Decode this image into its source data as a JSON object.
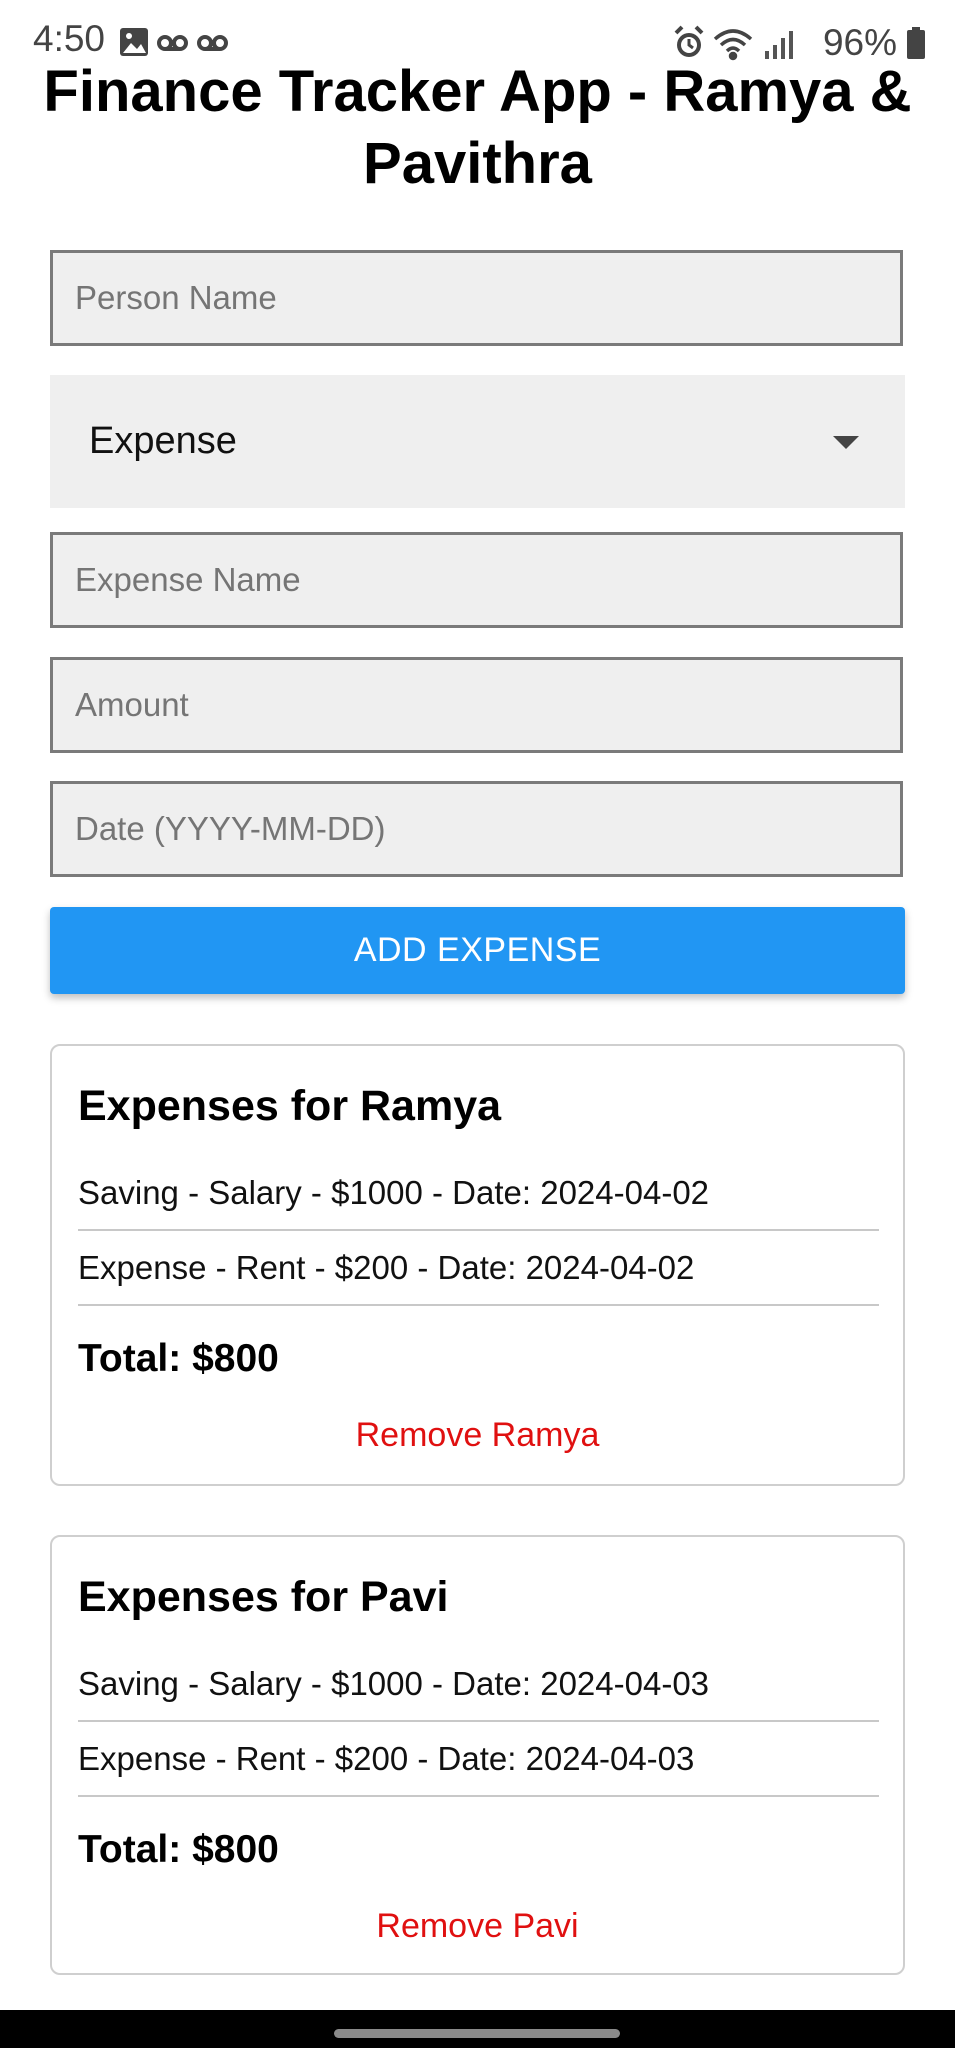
{
  "status_bar": {
    "time": "4:50",
    "battery": "96%",
    "icons": [
      "gallery-icon",
      "voicemail-icon",
      "voicemail-icon",
      "alarm-icon",
      "wifi-icon",
      "signal-icon",
      "battery-icon"
    ]
  },
  "app": {
    "title": "Finance Tracker App  - Ramya & Pavithra"
  },
  "form": {
    "person_placeholder": "Person Name",
    "type_selected": "Expense",
    "expense_name_placeholder": "Expense Name",
    "amount_placeholder": "Amount",
    "date_placeholder": "Date (YYYY-MM-DD)",
    "add_button_label": "ADD EXPENSE"
  },
  "cards": [
    {
      "title": "Expenses for Ramya",
      "entries": [
        "Saving - Salary - $1000 - Date: 2024-04-02",
        "Expense - Rent - $200 - Date: 2024-04-02"
      ],
      "total": "Total: $800",
      "remove_label": "Remove Ramya"
    },
    {
      "title": "Expenses for Pavi",
      "entries": [
        "Saving - Salary - $1000 - Date: 2024-04-03",
        "Expense - Rent - $200 - Date: 2024-04-03"
      ],
      "total": "Total: $800",
      "remove_label": "Remove Pavi"
    }
  ],
  "colors": {
    "primary": "#2196f3",
    "danger": "#e01010",
    "field_bg": "#efefef"
  }
}
